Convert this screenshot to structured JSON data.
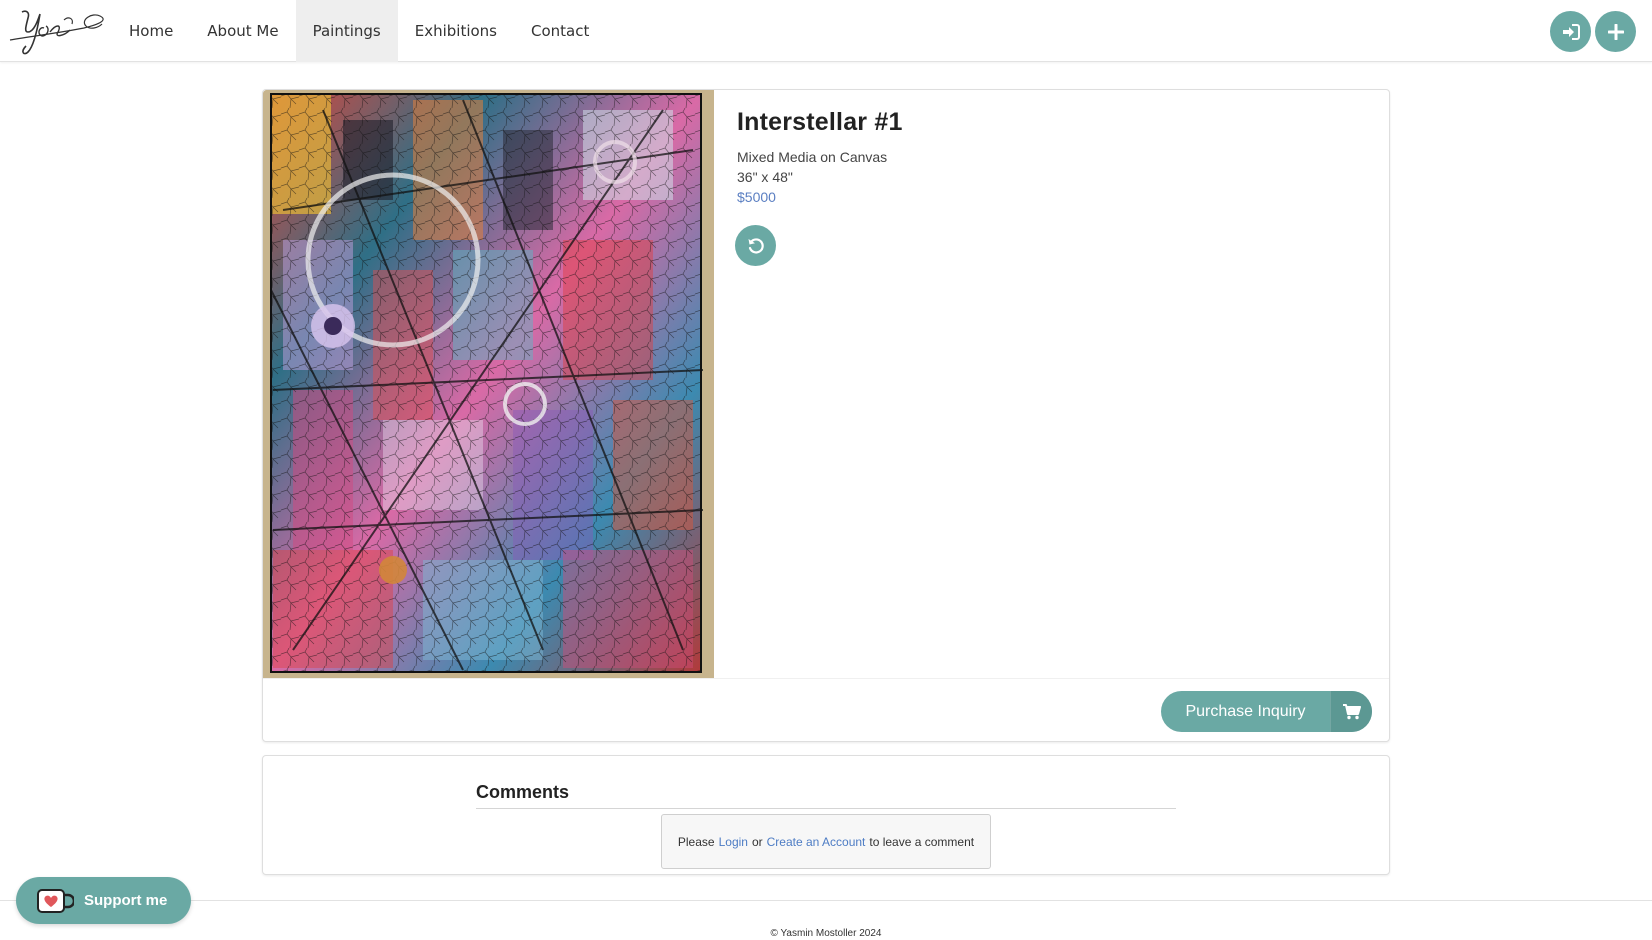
{
  "nav": {
    "logo_text": "Yos",
    "links": [
      {
        "label": "Home"
      },
      {
        "label": "About Me"
      },
      {
        "label": "Paintings"
      },
      {
        "label": "Exhibitions"
      },
      {
        "label": "Contact"
      }
    ],
    "active": "Paintings",
    "actions": [
      {
        "icon": "sign-in-icon"
      },
      {
        "icon": "plus-icon"
      }
    ]
  },
  "painting": {
    "title": "Interstellar #1",
    "medium": "Mixed Media on Canvas",
    "size": "36\" x 48\"",
    "price": "$5000",
    "reset_icon": "undo-icon",
    "purchase_label": "Purchase Inquiry",
    "purchase_icon": "cart-icon"
  },
  "comments": {
    "title": "Comments",
    "prompt_before": "Please",
    "login_link": "Login",
    "or_text": "or",
    "create_link": "Create an Account",
    "prompt_after": "to leave a comment"
  },
  "support": {
    "label": "Support me",
    "icon": "ko-fi-cup-icon"
  },
  "footer": {
    "copyright": "© Yasmin Mostoller 2024"
  },
  "colors": {
    "accent": "#6aa9a4",
    "link": "#5b7fc2"
  }
}
